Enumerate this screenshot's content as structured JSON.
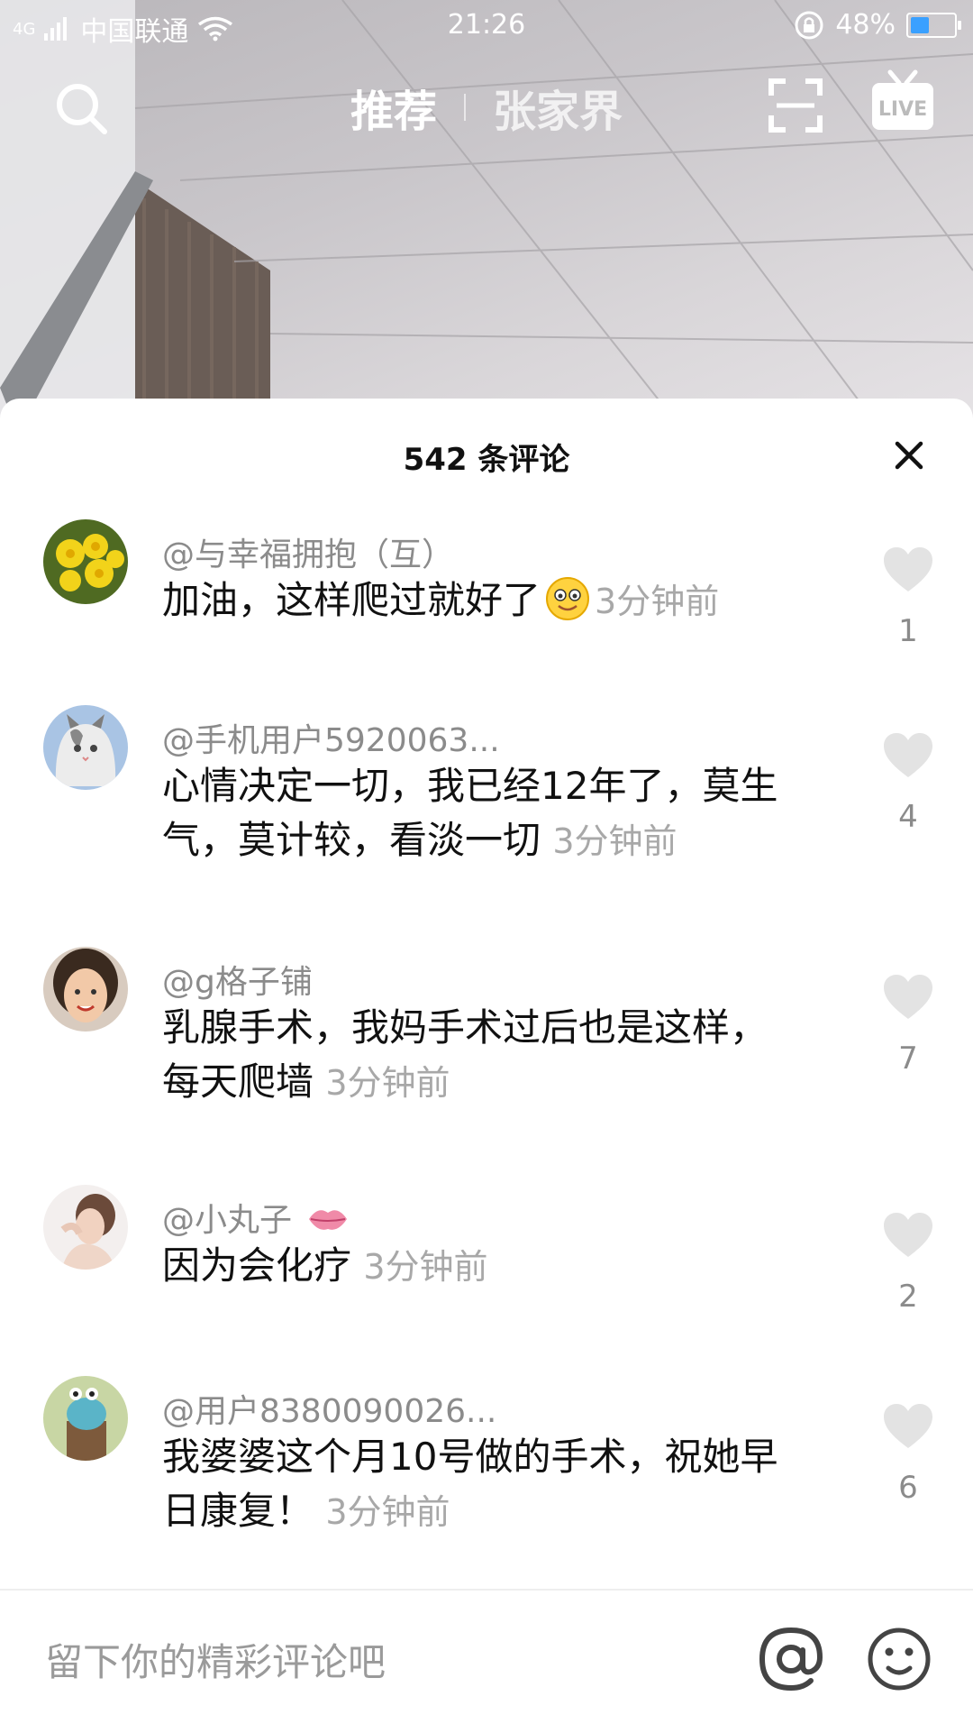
{
  "status_bar": {
    "network": "4G",
    "carrier": "中国联通",
    "time": "21:26",
    "battery": "48%",
    "battery_level": 0.48,
    "battery_color": "#3aa0ff"
  },
  "top_nav": {
    "tabs": [
      {
        "label": "推荐",
        "active": true
      },
      {
        "label": "张家界",
        "active": false
      }
    ],
    "live_label": "LIVE"
  },
  "comments_panel": {
    "title": "542 条评论",
    "comments": [
      {
        "user": "@与幸福拥抱（互）",
        "text": "加油，这样爬过就好了",
        "time": "3分钟前",
        "likes": "1",
        "avatar": "yellow-flower"
      },
      {
        "user": "@手机用户5920063...",
        "text": "心情决定一切，我已经12年了，莫生气，莫计较，看淡一切",
        "time": "3分钟前",
        "likes": "4",
        "avatar": "kitten"
      },
      {
        "user": "@g格子铺",
        "text": "乳腺手术，我妈手术过后也是这样，每天爬墙",
        "time": "3分钟前",
        "likes": "7",
        "avatar": "girl"
      },
      {
        "user": "@小丸子",
        "text": "因为会化疗",
        "time": "3分钟前",
        "likes": "2",
        "avatar": "woman"
      },
      {
        "user": "@用户8380090026...",
        "text": "我婆婆这个月10号做的手术，祝她早日康复！",
        "time": "3分钟前",
        "likes": "6",
        "avatar": "cartoon"
      }
    ]
  },
  "input": {
    "placeholder": "留下你的精彩评论吧"
  }
}
